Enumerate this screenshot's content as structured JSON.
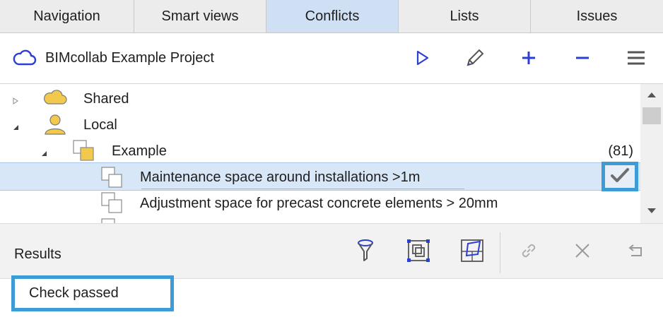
{
  "tabs": [
    {
      "label": "Navigation",
      "active": false
    },
    {
      "label": "Smart views",
      "active": false
    },
    {
      "label": "Conflicts",
      "active": true
    },
    {
      "label": "Lists",
      "active": false
    },
    {
      "label": "Issues",
      "active": false
    }
  ],
  "toolbar": {
    "project_title": "BIMcollab Example Project",
    "project_icon": "cloud-icon",
    "buttons": [
      "play-icon",
      "pencil-icon",
      "plus-icon",
      "minus-icon",
      "menu-icon"
    ]
  },
  "tree": {
    "items": [
      {
        "label": "Shared",
        "icon": "cloud-folder-icon",
        "expanded": false
      },
      {
        "label": "Local",
        "icon": "user-icon",
        "expanded": true
      },
      {
        "label": "Example",
        "icon": "ruleset-icon",
        "expanded": true,
        "count": "(81)"
      },
      {
        "label": "Maintenance space around installations >1m",
        "icon": "rule-icon",
        "selected": true,
        "status": "check-icon"
      },
      {
        "label": "Adjustment space for precast concrete elements > 20mm",
        "icon": "rule-icon",
        "selected": false
      }
    ]
  },
  "results": {
    "title": "Results",
    "buttons": [
      "filter-icon",
      "select-objects-icon",
      "section-box-icon",
      "link-icon",
      "close-icon",
      "undo-icon"
    ],
    "message": "Check passed"
  },
  "colors": {
    "accent": "#2b3fd1",
    "tab_active": "#cfe0f5",
    "selection": "#d8e7f8",
    "highlight_border": "#3d9bd6",
    "folder_yellow": "#f2c94c"
  }
}
